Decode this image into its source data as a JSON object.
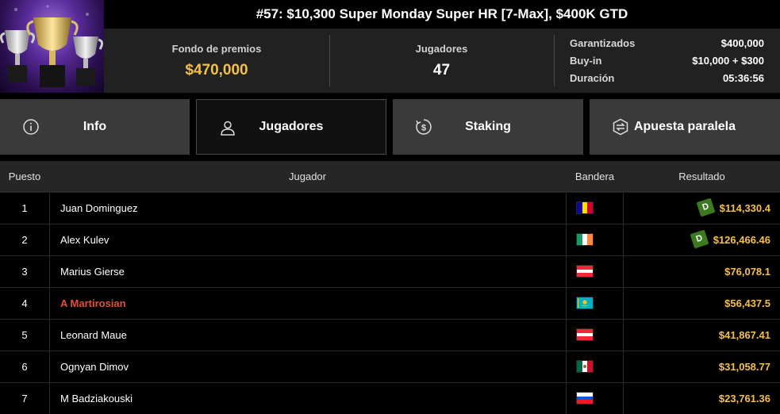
{
  "header": {
    "title": "#57: $10,300 Super Monday Super HR [7-Max], $400K GTD",
    "prize_pool_label": "Fondo de premios",
    "prize_pool_value": "$470,000",
    "players_label": "Jugadores",
    "players_value": "47",
    "details": [
      {
        "label": "Garantizados",
        "value": "$400,000"
      },
      {
        "label": "Buy-in",
        "value": "$10,000 + $300"
      },
      {
        "label": "Duración",
        "value": "05:36:56"
      }
    ]
  },
  "tabs": [
    {
      "label": "Info",
      "icon": "info-icon"
    },
    {
      "label": "Jugadores",
      "icon": "user-icon"
    },
    {
      "label": "Staking",
      "icon": "dollar-icon"
    },
    {
      "label": "Apuesta paralela",
      "icon": "side-bet-icon"
    }
  ],
  "table": {
    "headers": {
      "position": "Puesto",
      "player": "Jugador",
      "flag": "Bandera",
      "result": "Resultado"
    },
    "rows": [
      {
        "position": "1",
        "player": "Juan Dominguez",
        "flag": "andorra",
        "result": "$114,330.4",
        "badge": "D"
      },
      {
        "position": "2",
        "player": "Alex Kulev",
        "flag": "ireland",
        "result": "$126,466.46",
        "badge": "D"
      },
      {
        "position": "3",
        "player": "Marius Gierse",
        "flag": "austria",
        "result": "$76,078.1"
      },
      {
        "position": "4",
        "player": "A Martirosian",
        "flag": "kazakhstan",
        "result": "$56,437.5",
        "highlight": true
      },
      {
        "position": "5",
        "player": "Leonard Maue",
        "flag": "austria",
        "result": "$41,867.41"
      },
      {
        "position": "6",
        "player": "Ognyan Dimov",
        "flag": "mexico",
        "result": "$31,058.77"
      },
      {
        "position": "7",
        "player": "M Badziakouski",
        "flag": "slovenia",
        "result": "$23,761.36"
      }
    ]
  },
  "colors": {
    "accent": "#f4c04a",
    "highlight_name": "#e2503a",
    "badge": "#3d7a1f"
  }
}
